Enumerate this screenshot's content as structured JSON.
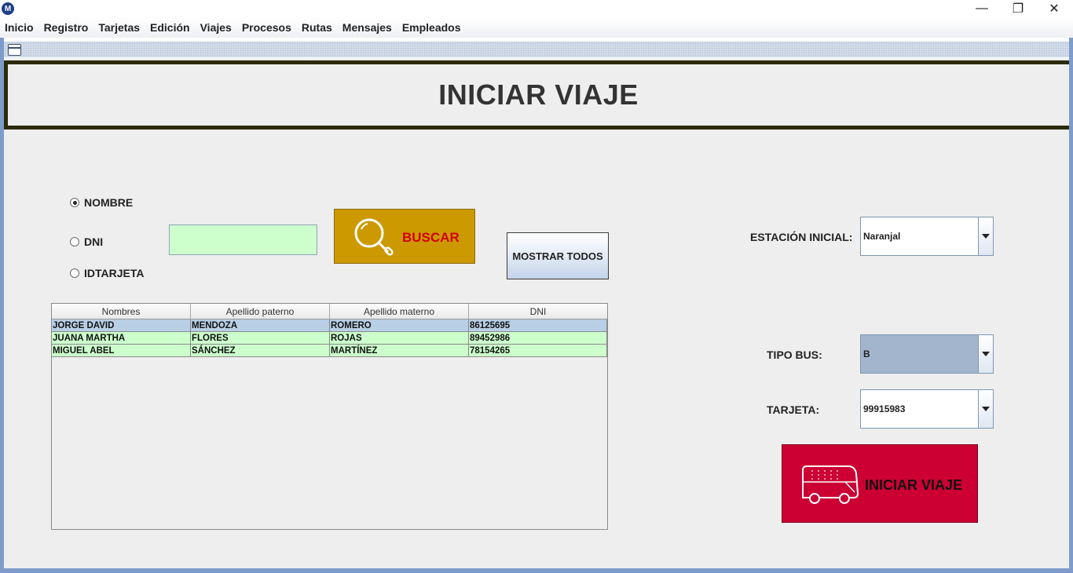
{
  "app": {
    "logo_glyph": "M"
  },
  "window_controls": {
    "minimize": "—",
    "restore": "❐",
    "close": "✕"
  },
  "menu": [
    "Inicio",
    "Registro",
    "Tarjetas",
    "Edición",
    "Viajes",
    "Procesos",
    "Rutas",
    "Mensajes",
    "Empleados"
  ],
  "header": {
    "title": "INICIAR VIAJE"
  },
  "search": {
    "options": [
      {
        "label": "NOMBRE",
        "checked": true
      },
      {
        "label": "DNI",
        "checked": false
      },
      {
        "label": "IDTARJETA",
        "checked": false
      }
    ],
    "input_value": "",
    "input_color": "#ccffcc",
    "buscar_label": "BUSCAR",
    "buscar_color": "#cc9900",
    "buscar_text_color": "#d20000",
    "mostrar_todos_label": "MOSTRAR TODOS"
  },
  "table": {
    "columns": [
      "Nombres",
      "Apellido paterno",
      "Apellido materno",
      "DNI"
    ],
    "rows": [
      {
        "cells": [
          "JORGE DAVID",
          "MENDOZA",
          "ROMERO",
          "86125695"
        ],
        "selected": true
      },
      {
        "cells": [
          "JUANA MARTHA",
          "FLORES",
          "ROJAS",
          "89452986"
        ],
        "selected": false
      },
      {
        "cells": [
          "MIGUEL ABEL",
          "SÁNCHEZ",
          "MARTÍNEZ",
          "78154265"
        ],
        "selected": false
      }
    ],
    "selected_row_color": "#b8cfe5",
    "row_color": "#ccffcc"
  },
  "form": {
    "estacion_label": "ESTACIÓN INICIAL:",
    "estacion_value": "Naranjal",
    "tipo_bus_label": "TIPO BUS:",
    "tipo_bus_value": "B",
    "tipo_bus_color": "#a3b5cc",
    "tarjeta_label": "TARJETA:",
    "tarjeta_value": "99915983"
  },
  "action": {
    "iniciar_label": "INICIAR VIAJE",
    "iniciar_color": "#cc0033",
    "icon": "bus-icon"
  }
}
